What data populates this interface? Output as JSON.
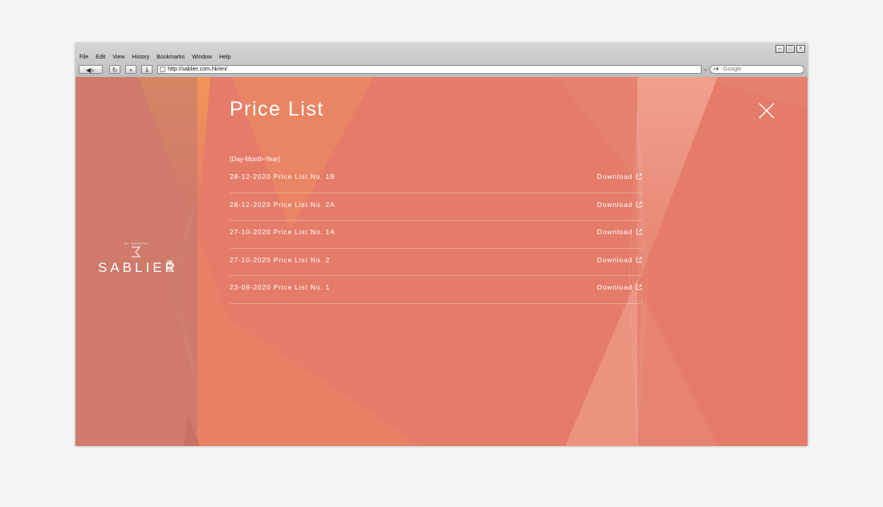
{
  "browser": {
    "menu": [
      "File",
      "Edit",
      "View",
      "History",
      "Bookmarks",
      "Window",
      "Help"
    ],
    "url": "http://sablier.com.hk/en/",
    "search_placeholder": "Google"
  },
  "sidebar": {
    "logo_small_text": "SE MOMENT",
    "logo_text": "SABLIER",
    "logo_cn": "曦巒"
  },
  "main": {
    "title": "Price List",
    "date_format": "(Day-Month-Year)",
    "items": [
      {
        "label": "28-12-2020 Price List No. 1B",
        "link": "Download"
      },
      {
        "label": "28-12-2020 Price List No. 2A",
        "link": "Download"
      },
      {
        "label": "27-10-2020 Price List No. 1A",
        "link": "Download"
      },
      {
        "label": "27-10-2020 Price List No. 2",
        "link": "Download"
      },
      {
        "label": "23-09-2020 Price List No. 1",
        "link": "Download"
      }
    ]
  },
  "colors": {
    "background": "#e47c69",
    "accent": "#f0a04f",
    "text": "#ffffff"
  }
}
